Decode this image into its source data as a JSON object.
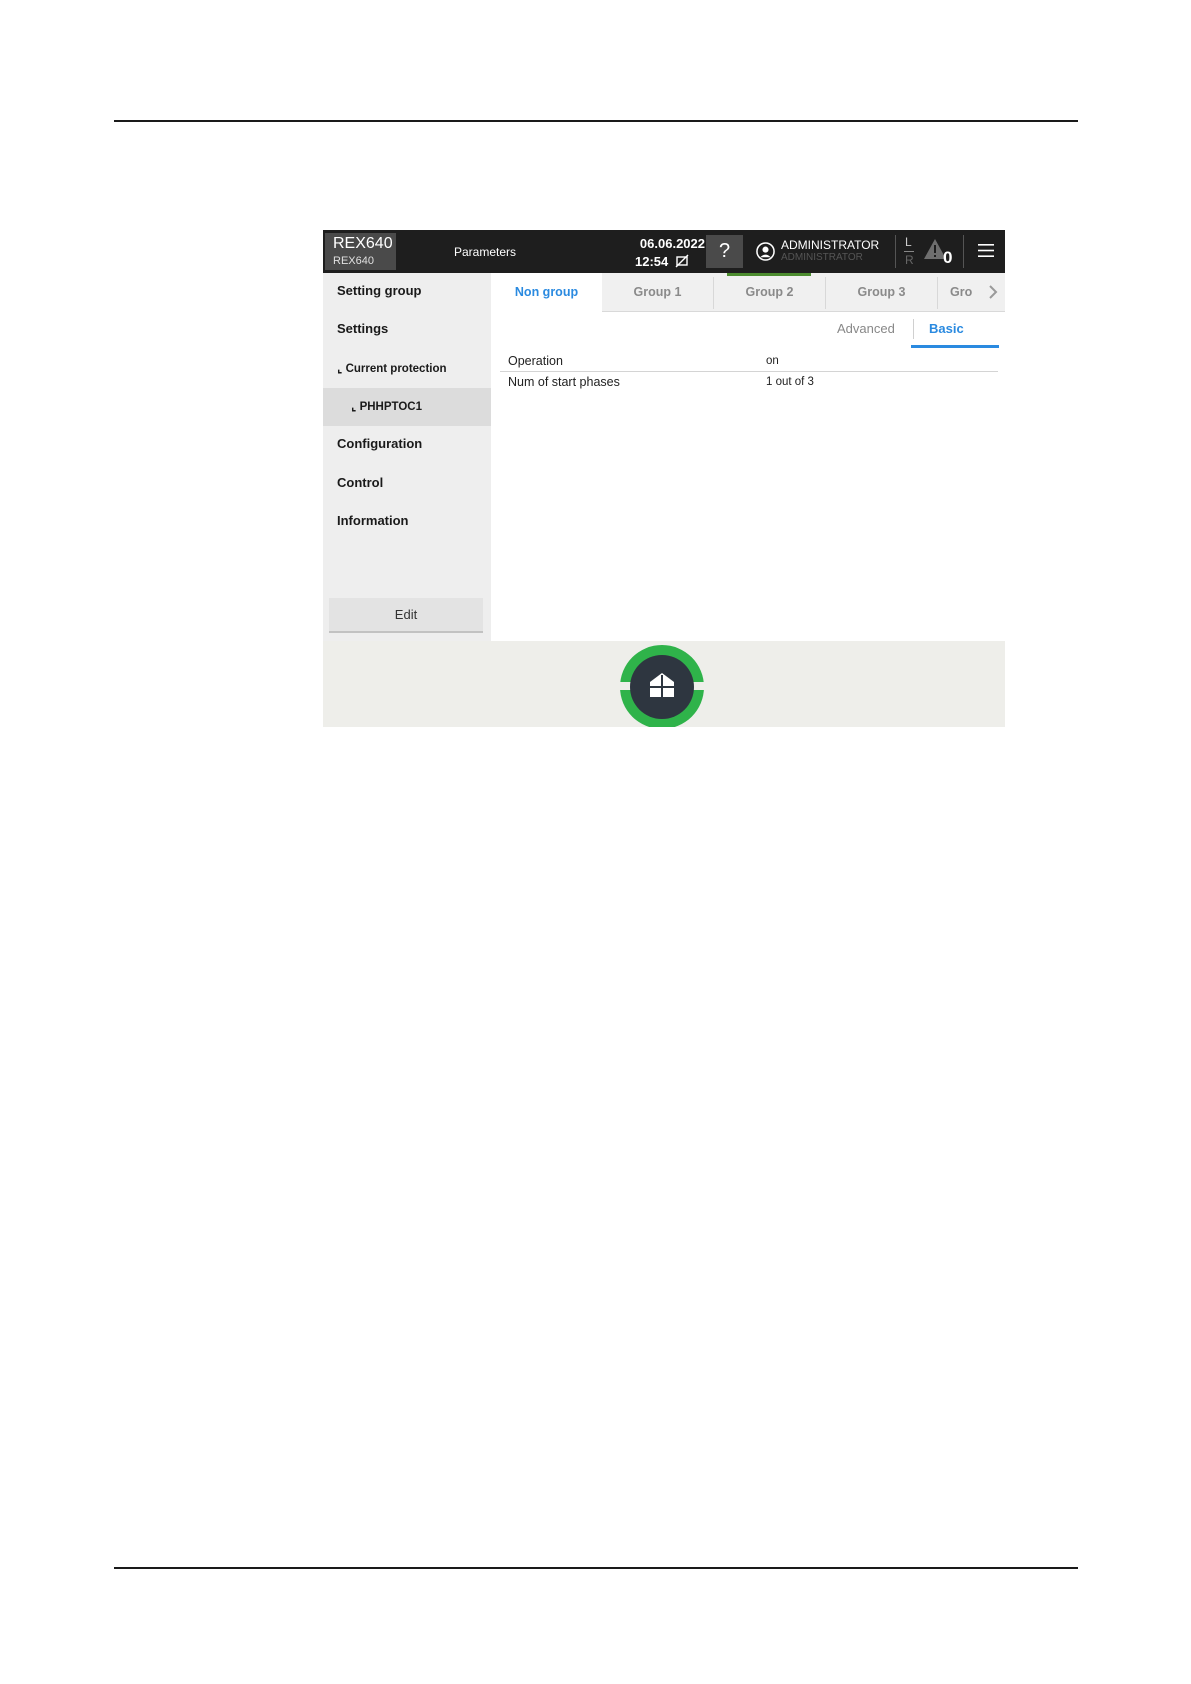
{
  "header": {
    "device_name": "REX640",
    "device_sub": "REX640",
    "title": "Parameters",
    "date": "06.06.2022",
    "time": "12:54",
    "help_label": "?",
    "user_name": "ADMINISTRATOR",
    "user_role": "ADMINISTRATOR",
    "local_label": "L",
    "remote_label": "R",
    "alarm_count": "0"
  },
  "sidebar": {
    "items": [
      {
        "label": "Setting group"
      },
      {
        "label": "Settings"
      },
      {
        "label": "⌞ Current protection"
      },
      {
        "label": "⌞ PHHPTOC1"
      },
      {
        "label": "Configuration"
      },
      {
        "label": "Control"
      },
      {
        "label": "Information"
      }
    ],
    "edit_label": "Edit"
  },
  "tabs": [
    {
      "label": "Non group"
    },
    {
      "label": "Group 1"
    },
    {
      "label": "Group 2"
    },
    {
      "label": "Group 3"
    },
    {
      "label": "Gro"
    }
  ],
  "view_toggle": {
    "advanced_label": "Advanced",
    "basic_label": "Basic"
  },
  "parameters": [
    {
      "name": "Operation",
      "value": "on"
    },
    {
      "name": "Num of start phases",
      "value": "1 out of 3"
    }
  ],
  "colors": {
    "header_bg": "#1e1e1e",
    "accent_blue": "#2a8ae0",
    "active_group_green": "#4c8c2f",
    "home_ring_green": "#2fb34a"
  },
  "icons": [
    "help-icon",
    "user-icon",
    "sync-off-icon",
    "warning-icon",
    "menu-icon",
    "chevron-right-icon",
    "home-icon"
  ]
}
